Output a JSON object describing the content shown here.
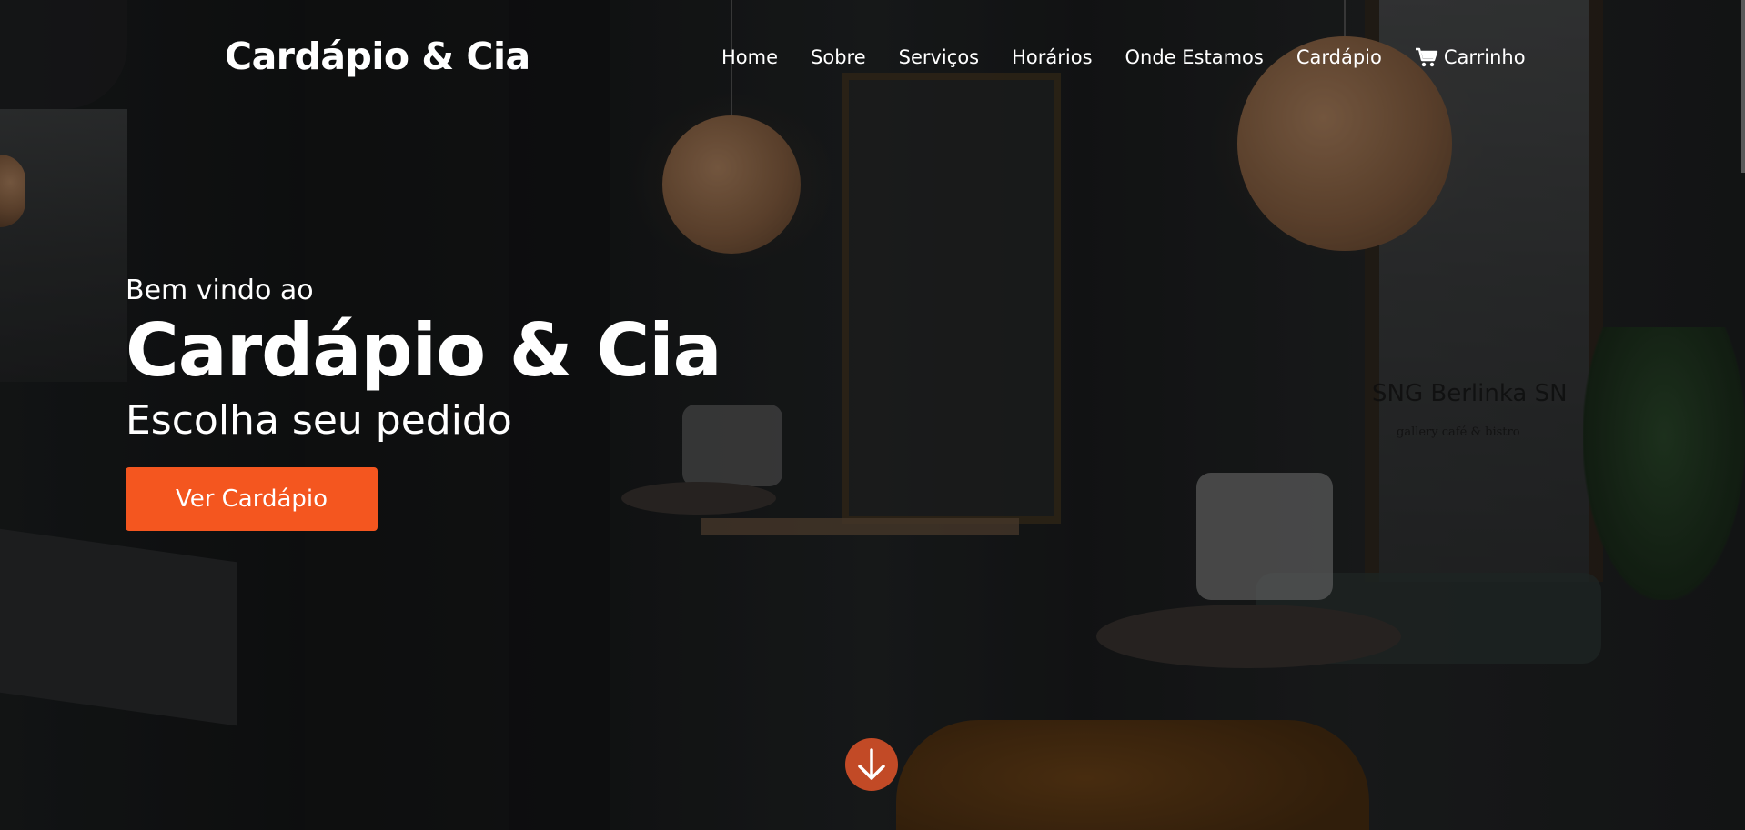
{
  "header": {
    "brand": "Cardápio & Cia",
    "nav": [
      {
        "label": "Home"
      },
      {
        "label": "Sobre"
      },
      {
        "label": "Serviços"
      },
      {
        "label": "Horários"
      },
      {
        "label": "Onde Estamos"
      },
      {
        "label": "Cardápio"
      },
      {
        "label": "Carrinho",
        "icon": "shopping-cart-icon"
      }
    ]
  },
  "hero": {
    "welcome": "Bem vindo ao",
    "title": "Cardápio & Cia",
    "subtitle": "Escolha seu pedido",
    "cta_label": "Ver Cardápio",
    "scroll_icon": "arrow-down-icon",
    "background_sign": "SNG Berlinka SN",
    "background_sign_small": "gallery café & bistro"
  },
  "colors": {
    "accent": "#f4561f",
    "scroll_button": "#c24a26",
    "text": "#ffffff"
  }
}
